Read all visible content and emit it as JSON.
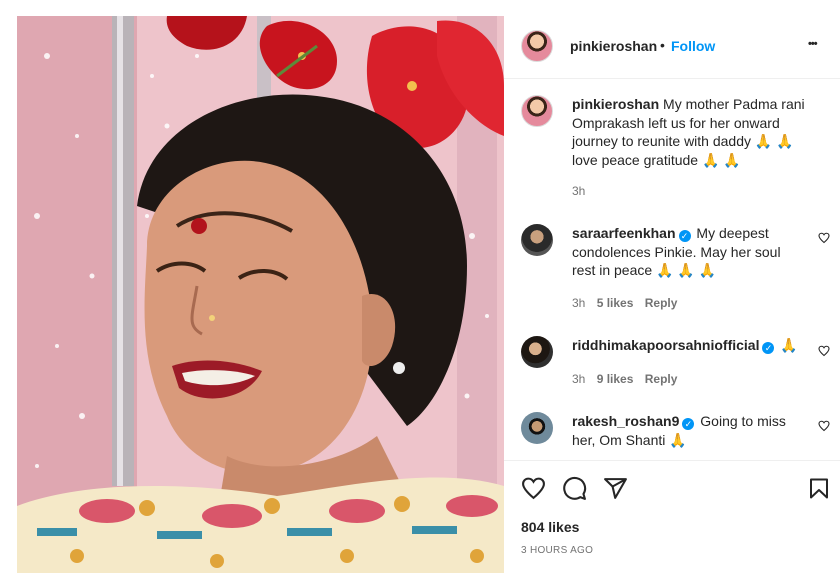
{
  "header": {
    "username": "pinkieroshan",
    "separator": "•",
    "follow_label": "Follow",
    "more_label": "•••"
  },
  "caption": {
    "username": "pinkieroshan",
    "text": "My mother Padma rani Omprakash left us for her onward journey to reunite with daddy 🙏 🙏 love peace gratitude 🙏 🙏",
    "time": "3h"
  },
  "comments": [
    {
      "username": "saraarfeenkhan",
      "verified": true,
      "text": "My deepest condolences Pinkie. May her soul rest in peace 🙏 🙏 🙏",
      "time": "3h",
      "likes": "5 likes",
      "reply": "Reply"
    },
    {
      "username": "riddhimakapoorsahniofficial",
      "verified": true,
      "text": "🙏",
      "time": "3h",
      "likes": "9 likes",
      "reply": "Reply"
    },
    {
      "username": "rakesh_roshan9",
      "verified": true,
      "text": "Going to miss her, Om Shanti 🙏",
      "time": "",
      "likes": "",
      "reply": ""
    }
  ],
  "actions": {
    "like_icon": "heart-icon",
    "comment_icon": "comment-icon",
    "share_icon": "share-icon",
    "save_icon": "bookmark-icon"
  },
  "post": {
    "likes": "804 likes",
    "time_ago": "3 HOURS AGO"
  },
  "colors": {
    "link": "#0095f6",
    "text": "#262626",
    "muted": "#737373"
  }
}
